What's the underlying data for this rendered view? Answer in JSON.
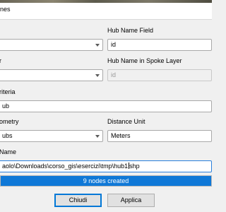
{
  "window": {
    "title": "nes"
  },
  "left_col": {
    "hub_layer_combo": {
      "value": ""
    },
    "spoke_layer_label": "r",
    "spoke_layer_combo": {
      "value": ""
    },
    "criteria_label": "riteria",
    "criteria_combo": {
      "value": "ub"
    },
    "geometry_label": "ometry",
    "geometry_combo": {
      "value": "ubs"
    },
    "output_label": "Name"
  },
  "right_col": {
    "hub_name_field_label": "Hub Name Field",
    "hub_name_field_input": {
      "value": "id"
    },
    "hub_name_spoke_label": "Hub Name in Spoke Layer",
    "hub_name_spoke_input": {
      "value": "id"
    },
    "distance_unit_label": "Distance Unit",
    "distance_unit_combo": {
      "value": "Meters"
    }
  },
  "output_path": {
    "before_cursor": "aolo\\Downloads\\corso_gis\\esercizi\\tmp\\hub1",
    "after_cursor": "shp"
  },
  "progress": {
    "text": "9 nodes created",
    "fraction": 1.0
  },
  "buttons": {
    "close": "Chiudi",
    "apply": "Applica"
  }
}
